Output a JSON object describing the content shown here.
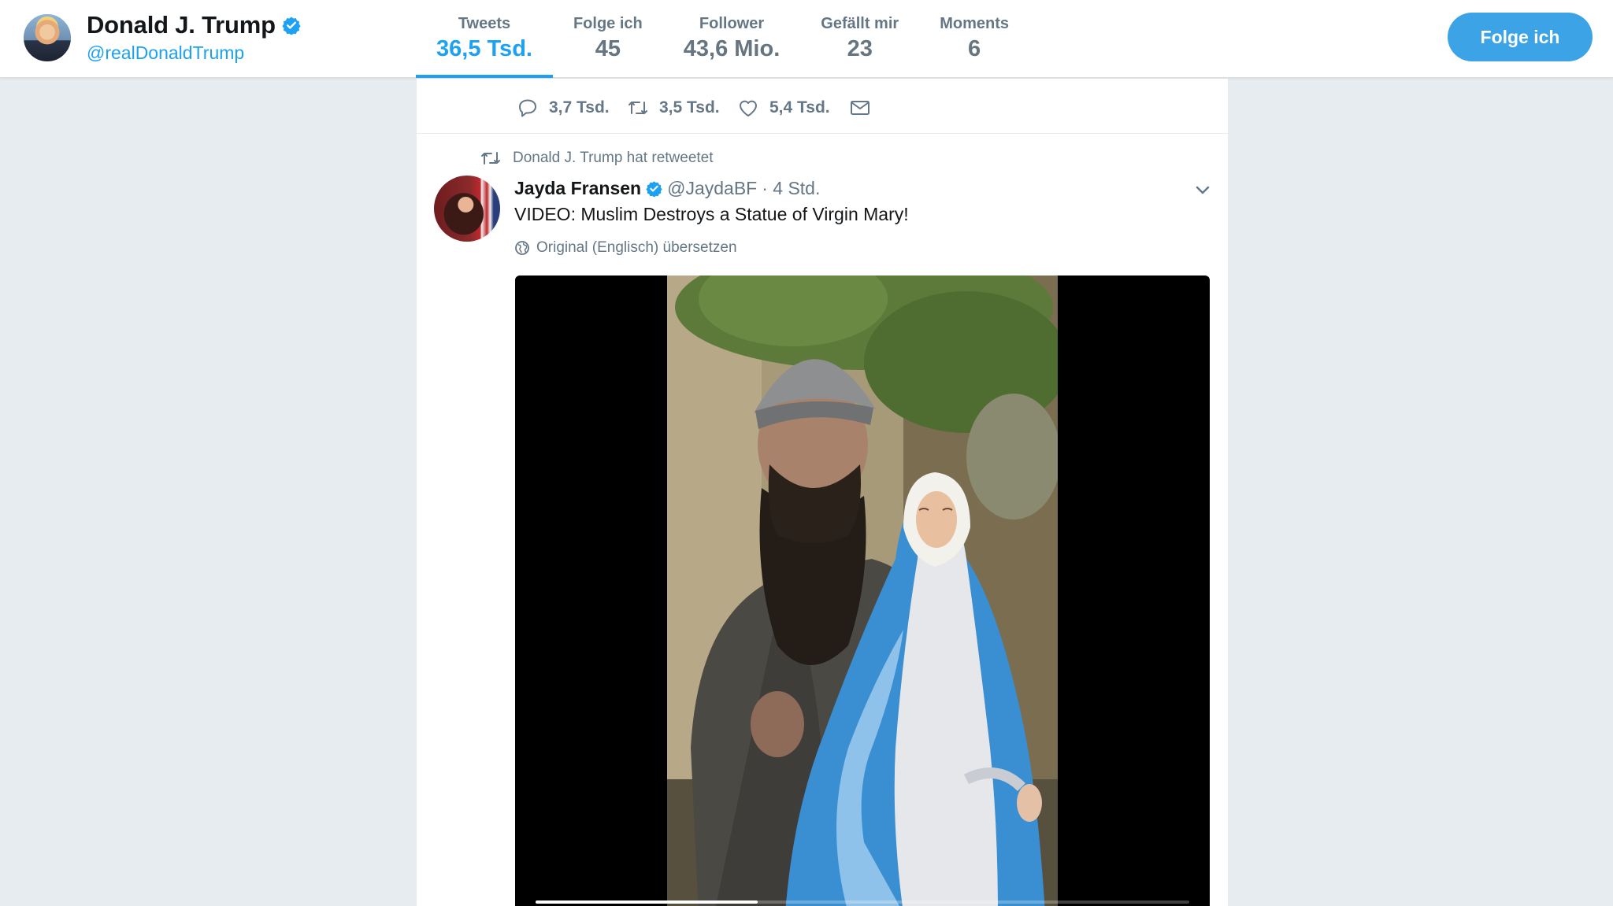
{
  "profile": {
    "name": "Donald J. Trump",
    "handle": "@realDonaldTrump",
    "verified": true,
    "avatar_icon": "profile-photo"
  },
  "stats": [
    {
      "label": "Tweets",
      "value": "36,5 Tsd.",
      "active": true
    },
    {
      "label": "Folge ich",
      "value": "45",
      "active": false
    },
    {
      "label": "Follower",
      "value": "43,6 Mio.",
      "active": false
    },
    {
      "label": "Gefällt mir",
      "value": "23",
      "active": false
    },
    {
      "label": "Moments",
      "value": "6",
      "active": false
    }
  ],
  "follow_button": {
    "label": "Folge ich"
  },
  "previous_tweet": {
    "replies": "3,7 Tsd.",
    "retweets": "3,5 Tsd.",
    "likes": "5,4 Tsd.",
    "icons": [
      "reply-icon",
      "retweet-icon",
      "like-icon",
      "direct-message-icon"
    ]
  },
  "tweet": {
    "retweet_context": "Donald J. Trump hat retweetet",
    "author": "Jayda Fransen",
    "verified": true,
    "handle": "@JaydaBF",
    "time": "· 4 Std.",
    "text": "VIDEO: Muslim Destroys a Statue of Virgin Mary!",
    "translate": "Original (Englisch) übersetzen",
    "video": {
      "progress_fraction": 0.34
    }
  },
  "colors": {
    "accent": "#1da1f2",
    "follow_button": "#3ba3e6",
    "secondary_text": "#657786",
    "background": "#e6ecf0"
  }
}
